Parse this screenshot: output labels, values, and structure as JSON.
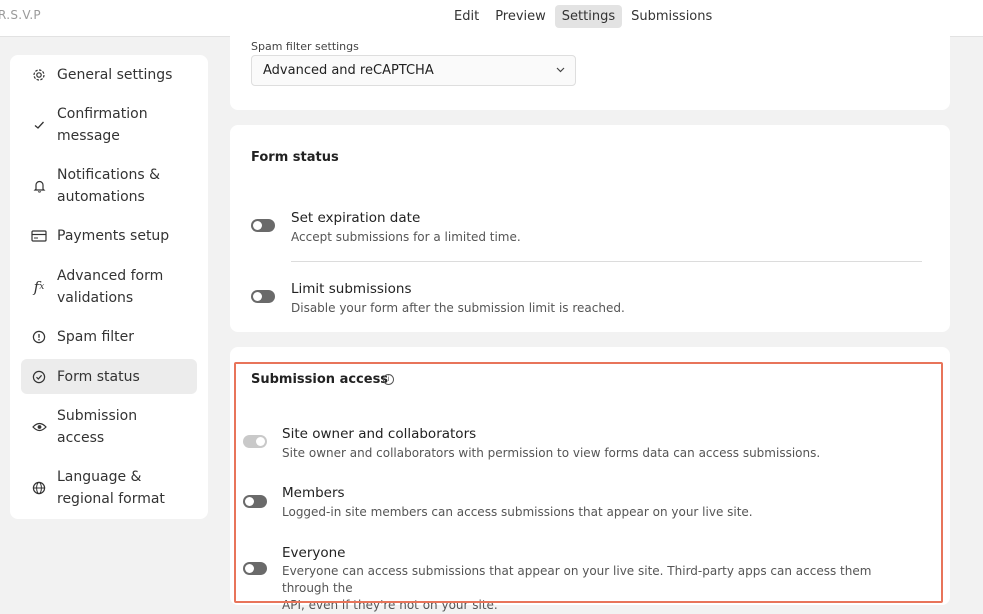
{
  "app_title": "R.S.V.P",
  "tabs": [
    {
      "label": "Edit"
    },
    {
      "label": "Preview"
    },
    {
      "label": "Settings",
      "active": true
    },
    {
      "label": "Submissions"
    }
  ],
  "sidebar": {
    "items": [
      {
        "label_line1": "General settings",
        "label_line2": "",
        "icon": "gear-icon"
      },
      {
        "label_line1": "Confirmation",
        "label_line2": "message",
        "icon": "check-icon"
      },
      {
        "label_line1": "Notifications &",
        "label_line2": "automations",
        "icon": "bell-icon"
      },
      {
        "label_line1": "Payments setup",
        "label_line2": "",
        "icon": "credit-card-icon"
      },
      {
        "label_line1": "Advanced form",
        "label_line2": "validations",
        "icon": "function-icon"
      },
      {
        "label_line1": "Spam filter",
        "label_line2": "",
        "icon": "alert-circle-icon"
      },
      {
        "label_line1": "Form status",
        "label_line2": "",
        "icon": "check-circle-icon",
        "active": true
      },
      {
        "label_line1": "Submission",
        "label_line2": "access",
        "icon": "eye-icon"
      },
      {
        "label_line1": "Language &",
        "label_line2": "regional format",
        "icon": "globe-icon"
      }
    ]
  },
  "spam": {
    "label": "Spam filter settings",
    "value": "Advanced and reCAPTCHA"
  },
  "form_status": {
    "title": "Form status",
    "rows": [
      {
        "title": "Set expiration date",
        "desc": "Accept submissions for a limited time.",
        "enabled": false
      },
      {
        "title": "Limit submissions",
        "desc": "Disable your form after the submission limit is reached.",
        "enabled": false
      }
    ]
  },
  "submission_access": {
    "title": "Submission access",
    "rows": [
      {
        "title": "Site owner and collaborators",
        "desc_line1": "Site owner and collaborators with permission to view forms data can access submissions.",
        "desc_line2": "",
        "enabled": true,
        "disabled": true
      },
      {
        "title": "Members",
        "desc_line1": "Logged-in site members can access submissions that appear on your live site.",
        "desc_line2": "",
        "enabled": false
      },
      {
        "title": "Everyone",
        "desc_line1": "Everyone can access submissions that appear on your live site. Third-party apps can access them through the",
        "desc_line2": "API, even if they're not on your site.",
        "enabled": false
      }
    ]
  },
  "colors": {
    "highlight": "#e8745a",
    "toggle_off": "#6a6a6a",
    "toggle_disabled": "#c9c9c9"
  }
}
